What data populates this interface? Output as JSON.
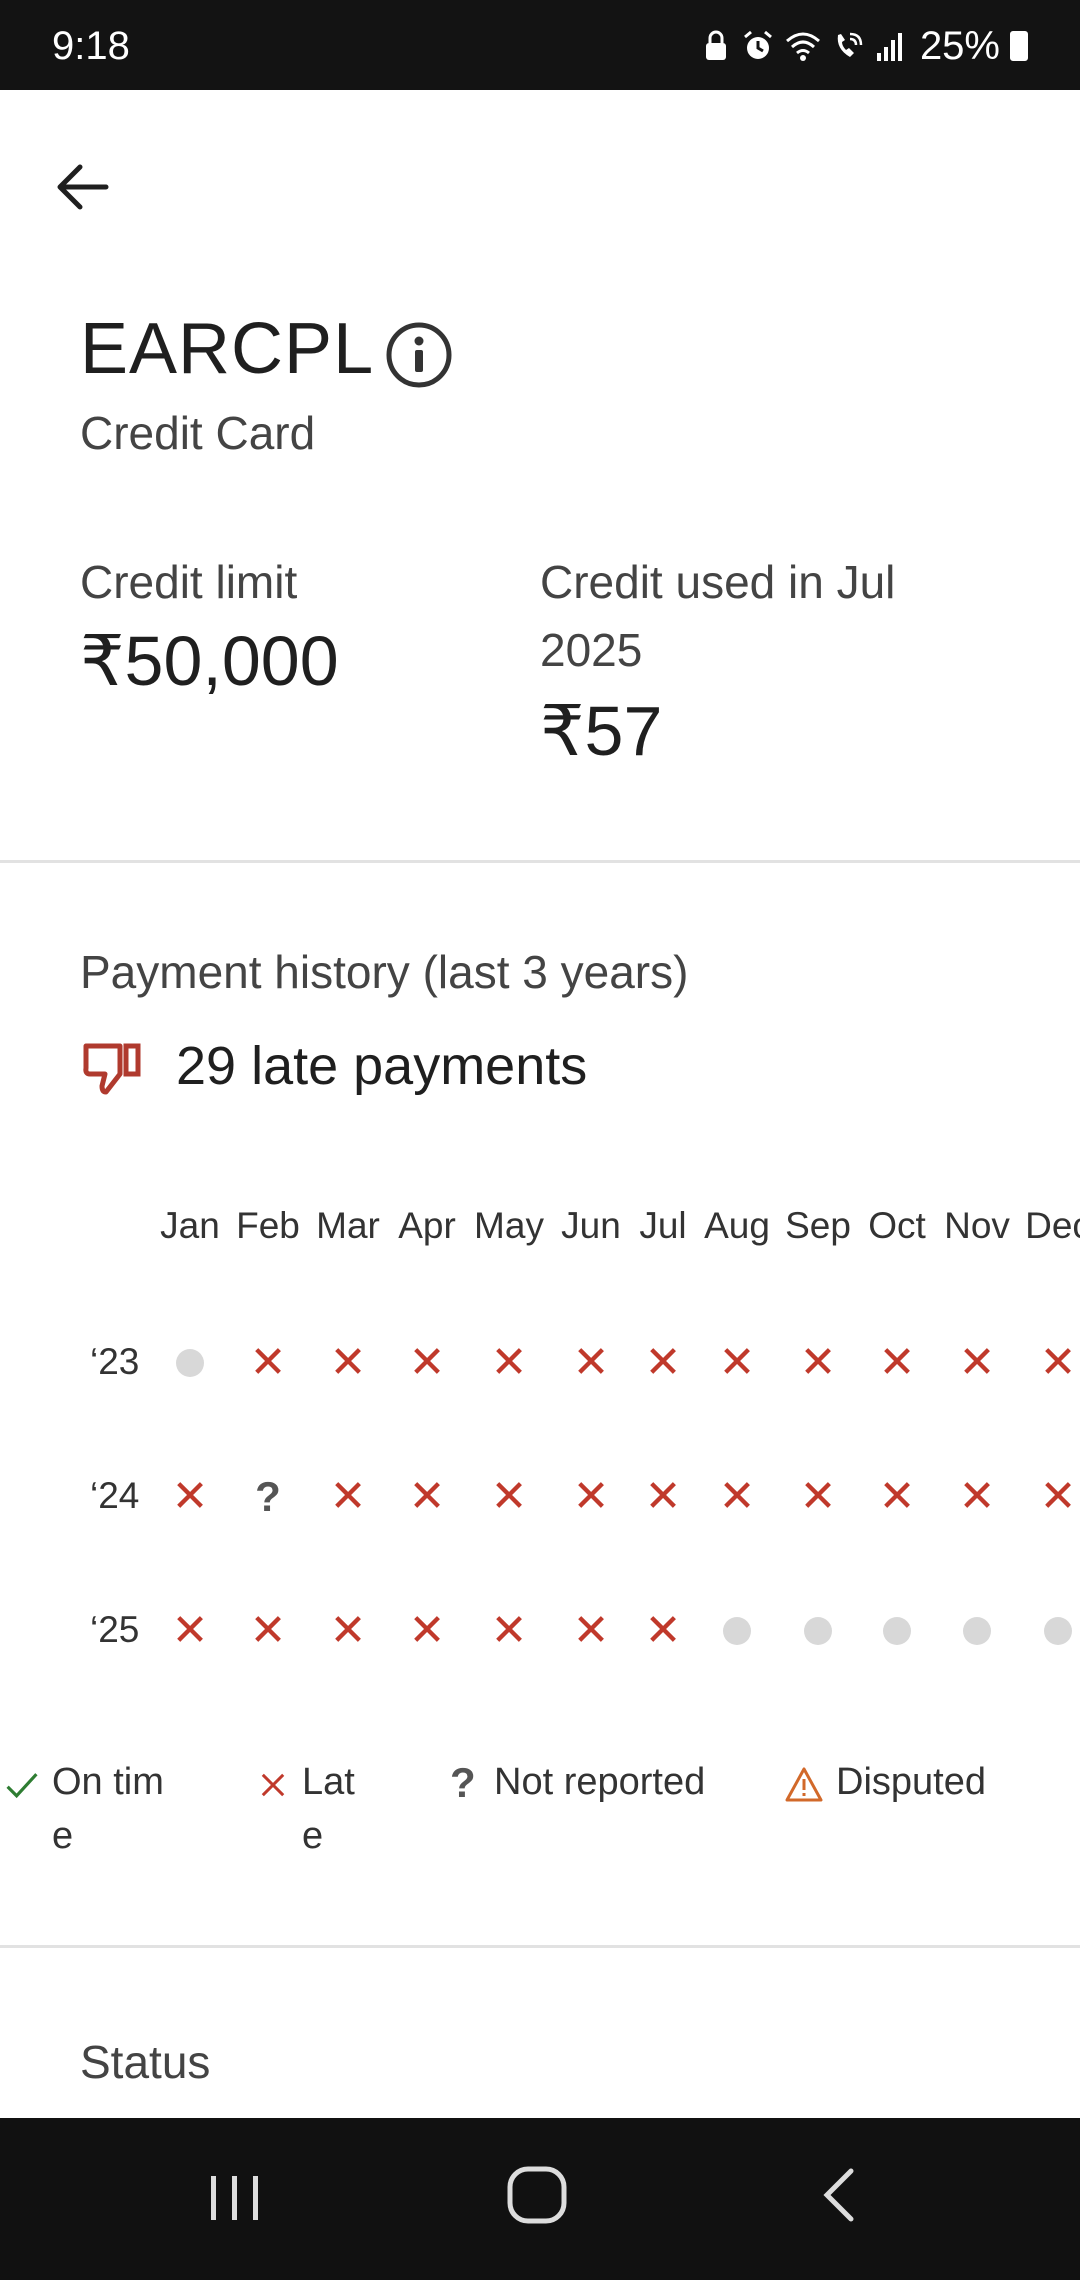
{
  "status_bar": {
    "time": "9:18",
    "battery": "25%"
  },
  "header": {
    "title": "EARCPL",
    "subtitle": "Credit Card"
  },
  "credit": {
    "limit_label": "Credit limit",
    "limit_value": "₹50,000",
    "used_label": "Credit used in Jul 2025",
    "used_value": "₹57"
  },
  "payment_history": {
    "title": "Payment history (last 3 years)",
    "late_summary": "29 late payments",
    "months": [
      "Jan",
      "Feb",
      "Mar",
      "Apr",
      "May",
      "Jun",
      "Jul",
      "Aug",
      "Sep",
      "Oct",
      "Nov",
      "Dec"
    ],
    "rows": [
      {
        "year": "‘23",
        "statuses": [
          "none",
          "late",
          "late",
          "late",
          "late",
          "late",
          "late",
          "late",
          "late",
          "late",
          "late",
          "late"
        ]
      },
      {
        "year": "‘24",
        "statuses": [
          "late",
          "unknown",
          "late",
          "late",
          "late",
          "late",
          "late",
          "late",
          "late",
          "late",
          "late",
          "late"
        ]
      },
      {
        "year": "‘25",
        "statuses": [
          "late",
          "late",
          "late",
          "late",
          "late",
          "late",
          "late",
          "none",
          "none",
          "none",
          "none",
          "none"
        ]
      }
    ]
  },
  "legend": {
    "on_time": "On time",
    "late": "Late",
    "not_reported": "Not reported",
    "disputed": "Disputed"
  },
  "status_section": {
    "label": "Status"
  },
  "colors": {
    "late": "#c0392b",
    "on_time": "#2e7d32",
    "disputed": "#d2692a",
    "empty": "#d8d8d8"
  }
}
